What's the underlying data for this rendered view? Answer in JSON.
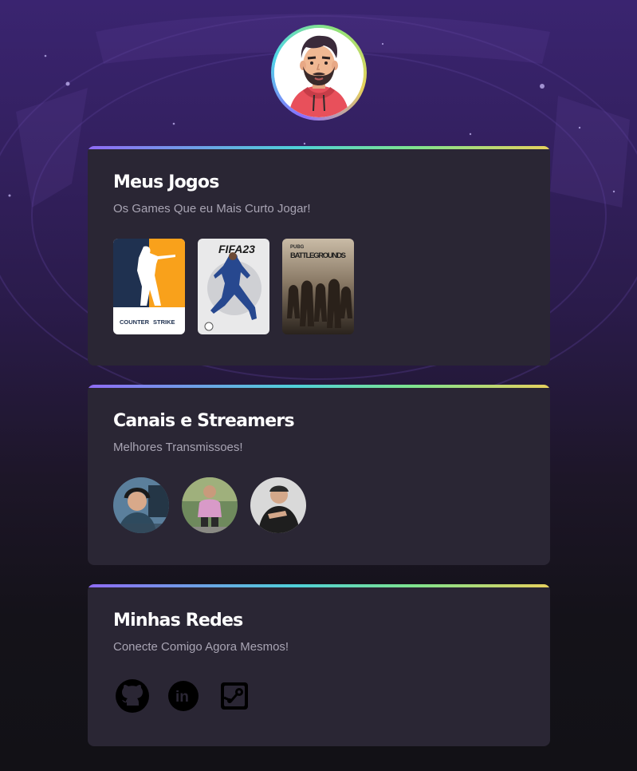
{
  "profile": {
    "avatar_alt": "avatar"
  },
  "games_card": {
    "title": "Meus Jogos",
    "subtitle": "Os Games Que eu Mais Curto Jogar!",
    "games": [
      {
        "name": "counter-strike",
        "brand_top": "COUNTER",
        "brand_bottom": "STRIKE"
      },
      {
        "name": "fifa-23",
        "label": "FIFA23"
      },
      {
        "name": "pubg",
        "label_small": "PUBG",
        "label": "BATTLEGROUNDS"
      }
    ]
  },
  "streamers_card": {
    "title": "Canais e Streamers",
    "subtitle": "Melhores Transmissoes!"
  },
  "social_card": {
    "title": "Minhas Redes",
    "subtitle": "Conecte Comigo Agora Mesmos!",
    "links": [
      {
        "name": "github-icon"
      },
      {
        "name": "linkedin-icon",
        "label": "in"
      },
      {
        "name": "steam-icon"
      }
    ]
  },
  "colors": {
    "card_bg": "#2a2634",
    "accent_gradient": [
      "#8f6bf5",
      "#4fd0d8",
      "#7de38f",
      "#e7d05d"
    ]
  }
}
